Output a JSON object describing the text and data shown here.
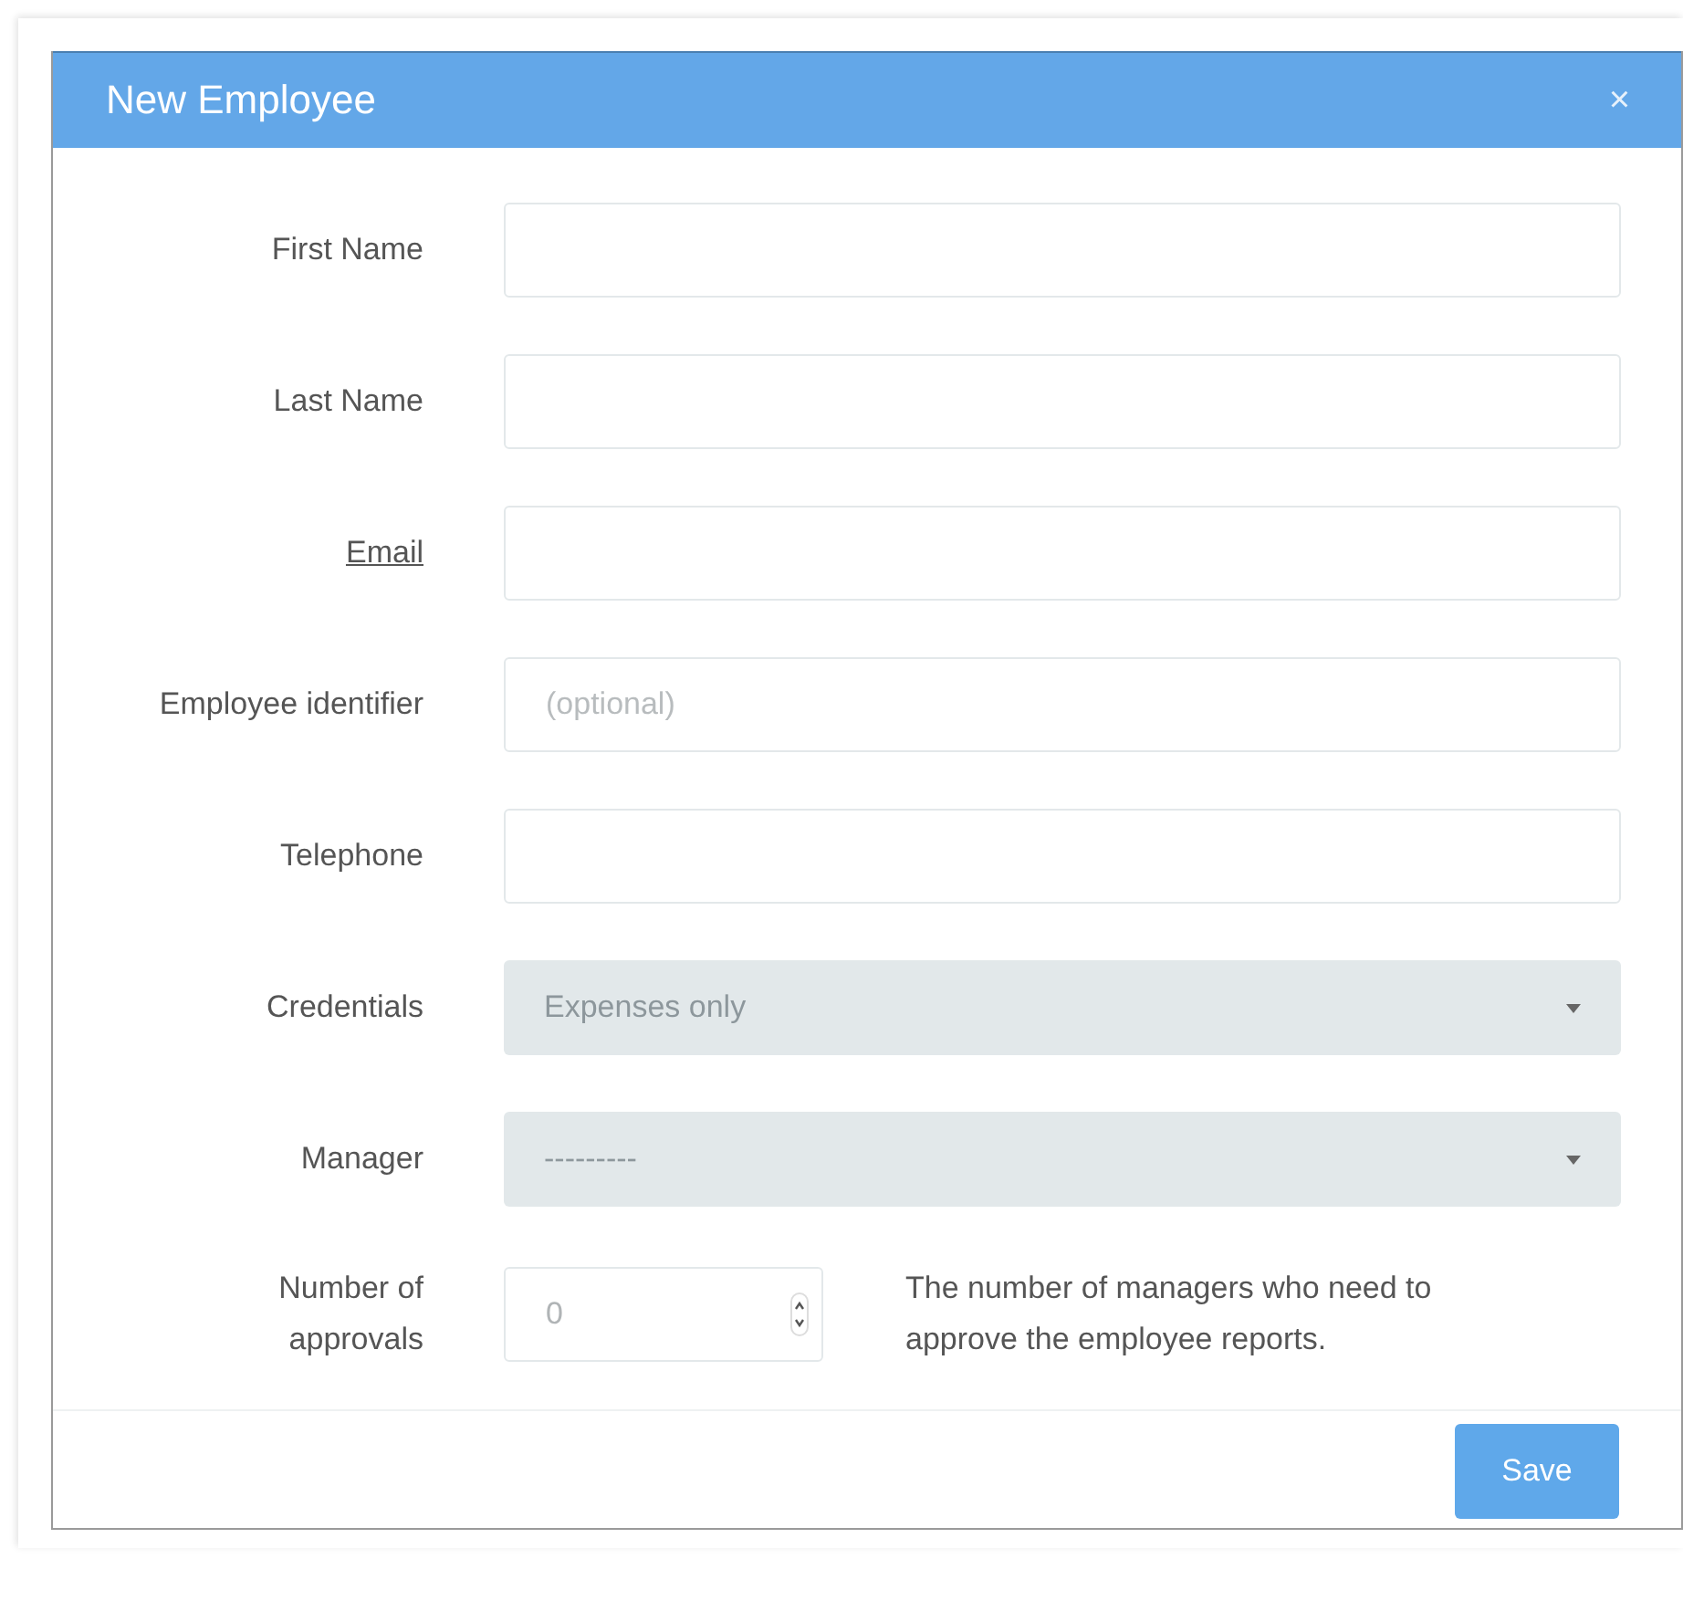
{
  "dialog": {
    "title": "New Employee",
    "close": "×"
  },
  "fields": [
    {
      "kind": "text",
      "label": "First Name",
      "label_underlined": false
    },
    {
      "kind": "text",
      "label": "Last Name",
      "label_underlined": false
    },
    {
      "kind": "text",
      "label": "Email",
      "label_underlined": true
    },
    {
      "kind": "text",
      "label": "Employee identifier",
      "label_underlined": false,
      "placeholder": "(optional)"
    },
    {
      "kind": "text",
      "label": "Telephone",
      "label_underlined": false
    },
    {
      "kind": "select",
      "label": "Credentials",
      "label_underlined": false,
      "value": "Expenses only"
    },
    {
      "kind": "select",
      "label": "Manager",
      "label_underlined": false,
      "value": "---------"
    },
    {
      "kind": "number",
      "label": "Number of approvals",
      "label_underlined": false,
      "value": "0",
      "help": "The number of managers who need to approve the employee reports."
    }
  ],
  "buttons": [
    "Save"
  ]
}
